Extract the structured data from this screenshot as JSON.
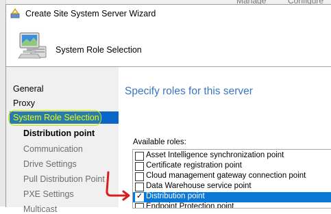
{
  "background": {
    "left_text": "Manage",
    "right_text": "Configure"
  },
  "window": {
    "title": "Create Site System Server Wizard",
    "app_icon": "wizard-icon",
    "banner_icon": "computer-icon",
    "banner_title": "System Role Selection"
  },
  "nav": {
    "items": [
      {
        "label": "General",
        "state": "normal"
      },
      {
        "label": "Proxy",
        "state": "normal"
      },
      {
        "label": "System Role Selection",
        "state": "selected"
      },
      {
        "label": "Distribution point",
        "state": "current"
      },
      {
        "label": "Communication",
        "state": "disabled"
      },
      {
        "label": "Drive Settings",
        "state": "disabled"
      },
      {
        "label": "Pull Distribution Point",
        "state": "disabled"
      },
      {
        "label": "PXE Settings",
        "state": "disabled"
      },
      {
        "label": "Multicast",
        "state": "disabled"
      }
    ]
  },
  "content": {
    "heading": "Specify roles for this server",
    "roles_label": "Available roles:",
    "roles": [
      {
        "label": "Asset Intelligence synchronization point",
        "checked": false,
        "selected": false
      },
      {
        "label": "Certificate registration point",
        "checked": false,
        "selected": false
      },
      {
        "label": "Cloud management gateway connection point",
        "checked": false,
        "selected": false
      },
      {
        "label": "Data Warehouse service point",
        "checked": false,
        "selected": false
      },
      {
        "label": "Distribution point",
        "checked": true,
        "selected": true
      },
      {
        "label": "Endpoint Protection point",
        "checked": false,
        "selected": false
      }
    ]
  },
  "colors": {
    "selection": "#0a78d7",
    "nav_selection": "#0a66c9",
    "heading": "#3976c2",
    "annotation_highlight": "#e8ff1a",
    "annotation_arrow": "#d81e1e"
  }
}
